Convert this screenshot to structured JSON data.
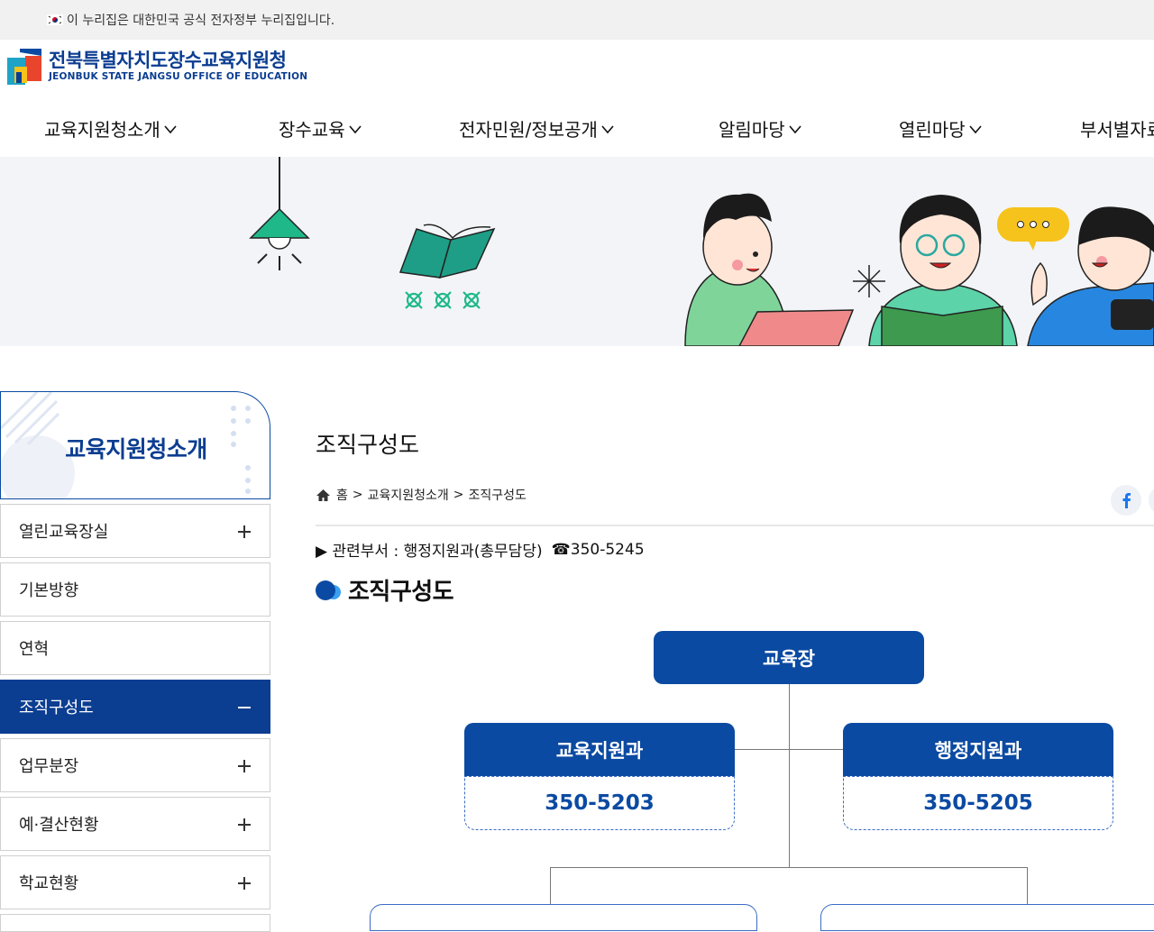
{
  "gov_bar": {
    "text": "이 누리집은 대한민국 공식 전자정부 누리집입니다."
  },
  "logo": {
    "name_ko": "전북특별자치도장수교육지원청",
    "name_en": "JEONBUK STATE JANGSU OFFICE OF EDUCATION"
  },
  "gnb": [
    {
      "label": "교육지원청소개"
    },
    {
      "label": "장수교육"
    },
    {
      "label": "전자민원/정보공개"
    },
    {
      "label": "알림마당"
    },
    {
      "label": "열린마당"
    },
    {
      "label": "부서별자료"
    }
  ],
  "side": {
    "title": "교육지원청소개",
    "items": [
      {
        "label": "열린교육장실",
        "state": "plus"
      },
      {
        "label": "기본방향",
        "state": "none"
      },
      {
        "label": "연혁",
        "state": "none"
      },
      {
        "label": "조직구성도",
        "state": "minus",
        "active": true
      },
      {
        "label": "업무분장",
        "state": "plus"
      },
      {
        "label": "예·결산현황",
        "state": "plus"
      },
      {
        "label": "학교현황",
        "state": "plus"
      }
    ]
  },
  "page": {
    "title": "조직구성도",
    "breadcrumb": {
      "home": "홈",
      "level1": "교육지원청소개",
      "level2": "조직구성도",
      "sep": ">"
    },
    "dept_line": "▶ 관련부서 : 행정지원과(총무담당)",
    "phone": "☎350-5245",
    "section_heading": "조직구성도"
  },
  "org": {
    "head": "교육장",
    "left": {
      "name": "교육지원과",
      "phone": "350-5203"
    },
    "right": {
      "name": "행정지원과",
      "phone": "350-5205"
    }
  },
  "colors": {
    "brand": "#0b3d91",
    "box": "#0b4aa2",
    "hero_bg": "#f3f4f7",
    "accent_green": "#1fb889"
  }
}
